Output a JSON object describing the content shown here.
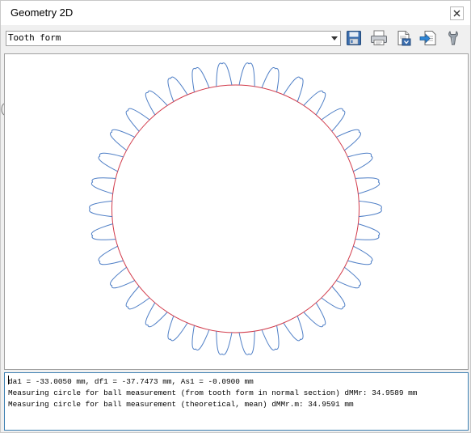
{
  "window": {
    "title": "Geometry 2D",
    "close_icon": "close-icon"
  },
  "toolbar": {
    "view_select": {
      "value": "Tooth form",
      "arrow_icon": "chevron-down-icon"
    },
    "buttons": [
      {
        "name": "save-button",
        "icon": "floppy-disk-icon"
      },
      {
        "name": "print-button",
        "icon": "printer-icon"
      },
      {
        "name": "export-button",
        "icon": "export-document-icon"
      },
      {
        "name": "send-button",
        "icon": "send-arrow-icon"
      },
      {
        "name": "settings-button",
        "icon": "wrench-icon"
      }
    ]
  },
  "drawing": {
    "tooth_count": 34,
    "colors": {
      "tooth_outline": "#4f7fc6",
      "measuring_circle": "#d23b4b",
      "background": "#ffffff"
    }
  },
  "output": {
    "lines": [
      "da1 = -33.0050 mm, df1 = -37.7473 mm, As1 = -0.0900 mm",
      "Measuring circle for ball measurement (from tooth form in normal section) dMMr: 34.9589 mm",
      "Measuring circle for ball measurement (theoretical, mean) dMMr.m: 34.9591 mm"
    ]
  }
}
